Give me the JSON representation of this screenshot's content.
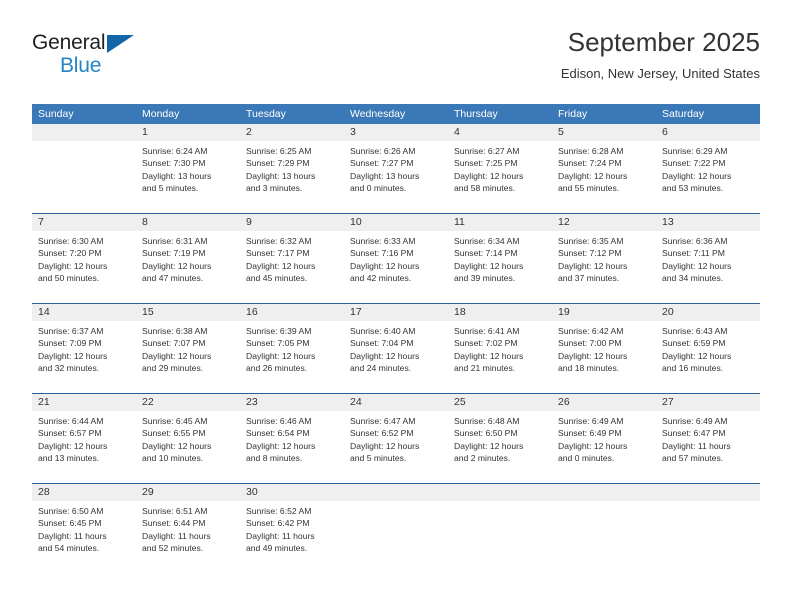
{
  "brand": {
    "name_part1": "General",
    "name_part2": "Blue",
    "mark": "triangle-icon",
    "color_dark": "#231f20",
    "color_blue": "#2484c6"
  },
  "header": {
    "title": "September 2025",
    "subtitle": "Edison, New Jersey, United States"
  },
  "theme": {
    "header_blue": "#3b78b8",
    "rule_blue": "#2a6099",
    "date_band_gray": "#efefef",
    "text": "#333333"
  },
  "calendar": {
    "weekday_headers": [
      "Sunday",
      "Monday",
      "Tuesday",
      "Wednesday",
      "Thursday",
      "Friday",
      "Saturday"
    ],
    "weeks": [
      {
        "dates": [
          "",
          "1",
          "2",
          "3",
          "4",
          "5",
          "6"
        ],
        "cells": [
          {
            "lines": []
          },
          {
            "lines": [
              "Sunrise: 6:24 AM",
              "Sunset: 7:30 PM",
              "Daylight: 13 hours",
              "and 5 minutes."
            ]
          },
          {
            "lines": [
              "Sunrise: 6:25 AM",
              "Sunset: 7:29 PM",
              "Daylight: 13 hours",
              "and 3 minutes."
            ]
          },
          {
            "lines": [
              "Sunrise: 6:26 AM",
              "Sunset: 7:27 PM",
              "Daylight: 13 hours",
              "and 0 minutes."
            ]
          },
          {
            "lines": [
              "Sunrise: 6:27 AM",
              "Sunset: 7:25 PM",
              "Daylight: 12 hours",
              "and 58 minutes."
            ]
          },
          {
            "lines": [
              "Sunrise: 6:28 AM",
              "Sunset: 7:24 PM",
              "Daylight: 12 hours",
              "and 55 minutes."
            ]
          },
          {
            "lines": [
              "Sunrise: 6:29 AM",
              "Sunset: 7:22 PM",
              "Daylight: 12 hours",
              "and 53 minutes."
            ]
          }
        ]
      },
      {
        "dates": [
          "7",
          "8",
          "9",
          "10",
          "11",
          "12",
          "13"
        ],
        "cells": [
          {
            "lines": [
              "Sunrise: 6:30 AM",
              "Sunset: 7:20 PM",
              "Daylight: 12 hours",
              "and 50 minutes."
            ]
          },
          {
            "lines": [
              "Sunrise: 6:31 AM",
              "Sunset: 7:19 PM",
              "Daylight: 12 hours",
              "and 47 minutes."
            ]
          },
          {
            "lines": [
              "Sunrise: 6:32 AM",
              "Sunset: 7:17 PM",
              "Daylight: 12 hours",
              "and 45 minutes."
            ]
          },
          {
            "lines": [
              "Sunrise: 6:33 AM",
              "Sunset: 7:16 PM",
              "Daylight: 12 hours",
              "and 42 minutes."
            ]
          },
          {
            "lines": [
              "Sunrise: 6:34 AM",
              "Sunset: 7:14 PM",
              "Daylight: 12 hours",
              "and 39 minutes."
            ]
          },
          {
            "lines": [
              "Sunrise: 6:35 AM",
              "Sunset: 7:12 PM",
              "Daylight: 12 hours",
              "and 37 minutes."
            ]
          },
          {
            "lines": [
              "Sunrise: 6:36 AM",
              "Sunset: 7:11 PM",
              "Daylight: 12 hours",
              "and 34 minutes."
            ]
          }
        ]
      },
      {
        "dates": [
          "14",
          "15",
          "16",
          "17",
          "18",
          "19",
          "20"
        ],
        "cells": [
          {
            "lines": [
              "Sunrise: 6:37 AM",
              "Sunset: 7:09 PM",
              "Daylight: 12 hours",
              "and 32 minutes."
            ]
          },
          {
            "lines": [
              "Sunrise: 6:38 AM",
              "Sunset: 7:07 PM",
              "Daylight: 12 hours",
              "and 29 minutes."
            ]
          },
          {
            "lines": [
              "Sunrise: 6:39 AM",
              "Sunset: 7:05 PM",
              "Daylight: 12 hours",
              "and 26 minutes."
            ]
          },
          {
            "lines": [
              "Sunrise: 6:40 AM",
              "Sunset: 7:04 PM",
              "Daylight: 12 hours",
              "and 24 minutes."
            ]
          },
          {
            "lines": [
              "Sunrise: 6:41 AM",
              "Sunset: 7:02 PM",
              "Daylight: 12 hours",
              "and 21 minutes."
            ]
          },
          {
            "lines": [
              "Sunrise: 6:42 AM",
              "Sunset: 7:00 PM",
              "Daylight: 12 hours",
              "and 18 minutes."
            ]
          },
          {
            "lines": [
              "Sunrise: 6:43 AM",
              "Sunset: 6:59 PM",
              "Daylight: 12 hours",
              "and 16 minutes."
            ]
          }
        ]
      },
      {
        "dates": [
          "21",
          "22",
          "23",
          "24",
          "25",
          "26",
          "27"
        ],
        "cells": [
          {
            "lines": [
              "Sunrise: 6:44 AM",
              "Sunset: 6:57 PM",
              "Daylight: 12 hours",
              "and 13 minutes."
            ]
          },
          {
            "lines": [
              "Sunrise: 6:45 AM",
              "Sunset: 6:55 PM",
              "Daylight: 12 hours",
              "and 10 minutes."
            ]
          },
          {
            "lines": [
              "Sunrise: 6:46 AM",
              "Sunset: 6:54 PM",
              "Daylight: 12 hours",
              "and 8 minutes."
            ]
          },
          {
            "lines": [
              "Sunrise: 6:47 AM",
              "Sunset: 6:52 PM",
              "Daylight: 12 hours",
              "and 5 minutes."
            ]
          },
          {
            "lines": [
              "Sunrise: 6:48 AM",
              "Sunset: 6:50 PM",
              "Daylight: 12 hours",
              "and 2 minutes."
            ]
          },
          {
            "lines": [
              "Sunrise: 6:49 AM",
              "Sunset: 6:49 PM",
              "Daylight: 12 hours",
              "and 0 minutes."
            ]
          },
          {
            "lines": [
              "Sunrise: 6:49 AM",
              "Sunset: 6:47 PM",
              "Daylight: 11 hours",
              "and 57 minutes."
            ]
          }
        ]
      },
      {
        "dates": [
          "28",
          "29",
          "30",
          "",
          "",
          "",
          ""
        ],
        "cells": [
          {
            "lines": [
              "Sunrise: 6:50 AM",
              "Sunset: 6:45 PM",
              "Daylight: 11 hours",
              "and 54 minutes."
            ]
          },
          {
            "lines": [
              "Sunrise: 6:51 AM",
              "Sunset: 6:44 PM",
              "Daylight: 11 hours",
              "and 52 minutes."
            ]
          },
          {
            "lines": [
              "Sunrise: 6:52 AM",
              "Sunset: 6:42 PM",
              "Daylight: 11 hours",
              "and 49 minutes."
            ]
          },
          {
            "lines": []
          },
          {
            "lines": []
          },
          {
            "lines": []
          },
          {
            "lines": []
          }
        ]
      }
    ]
  }
}
